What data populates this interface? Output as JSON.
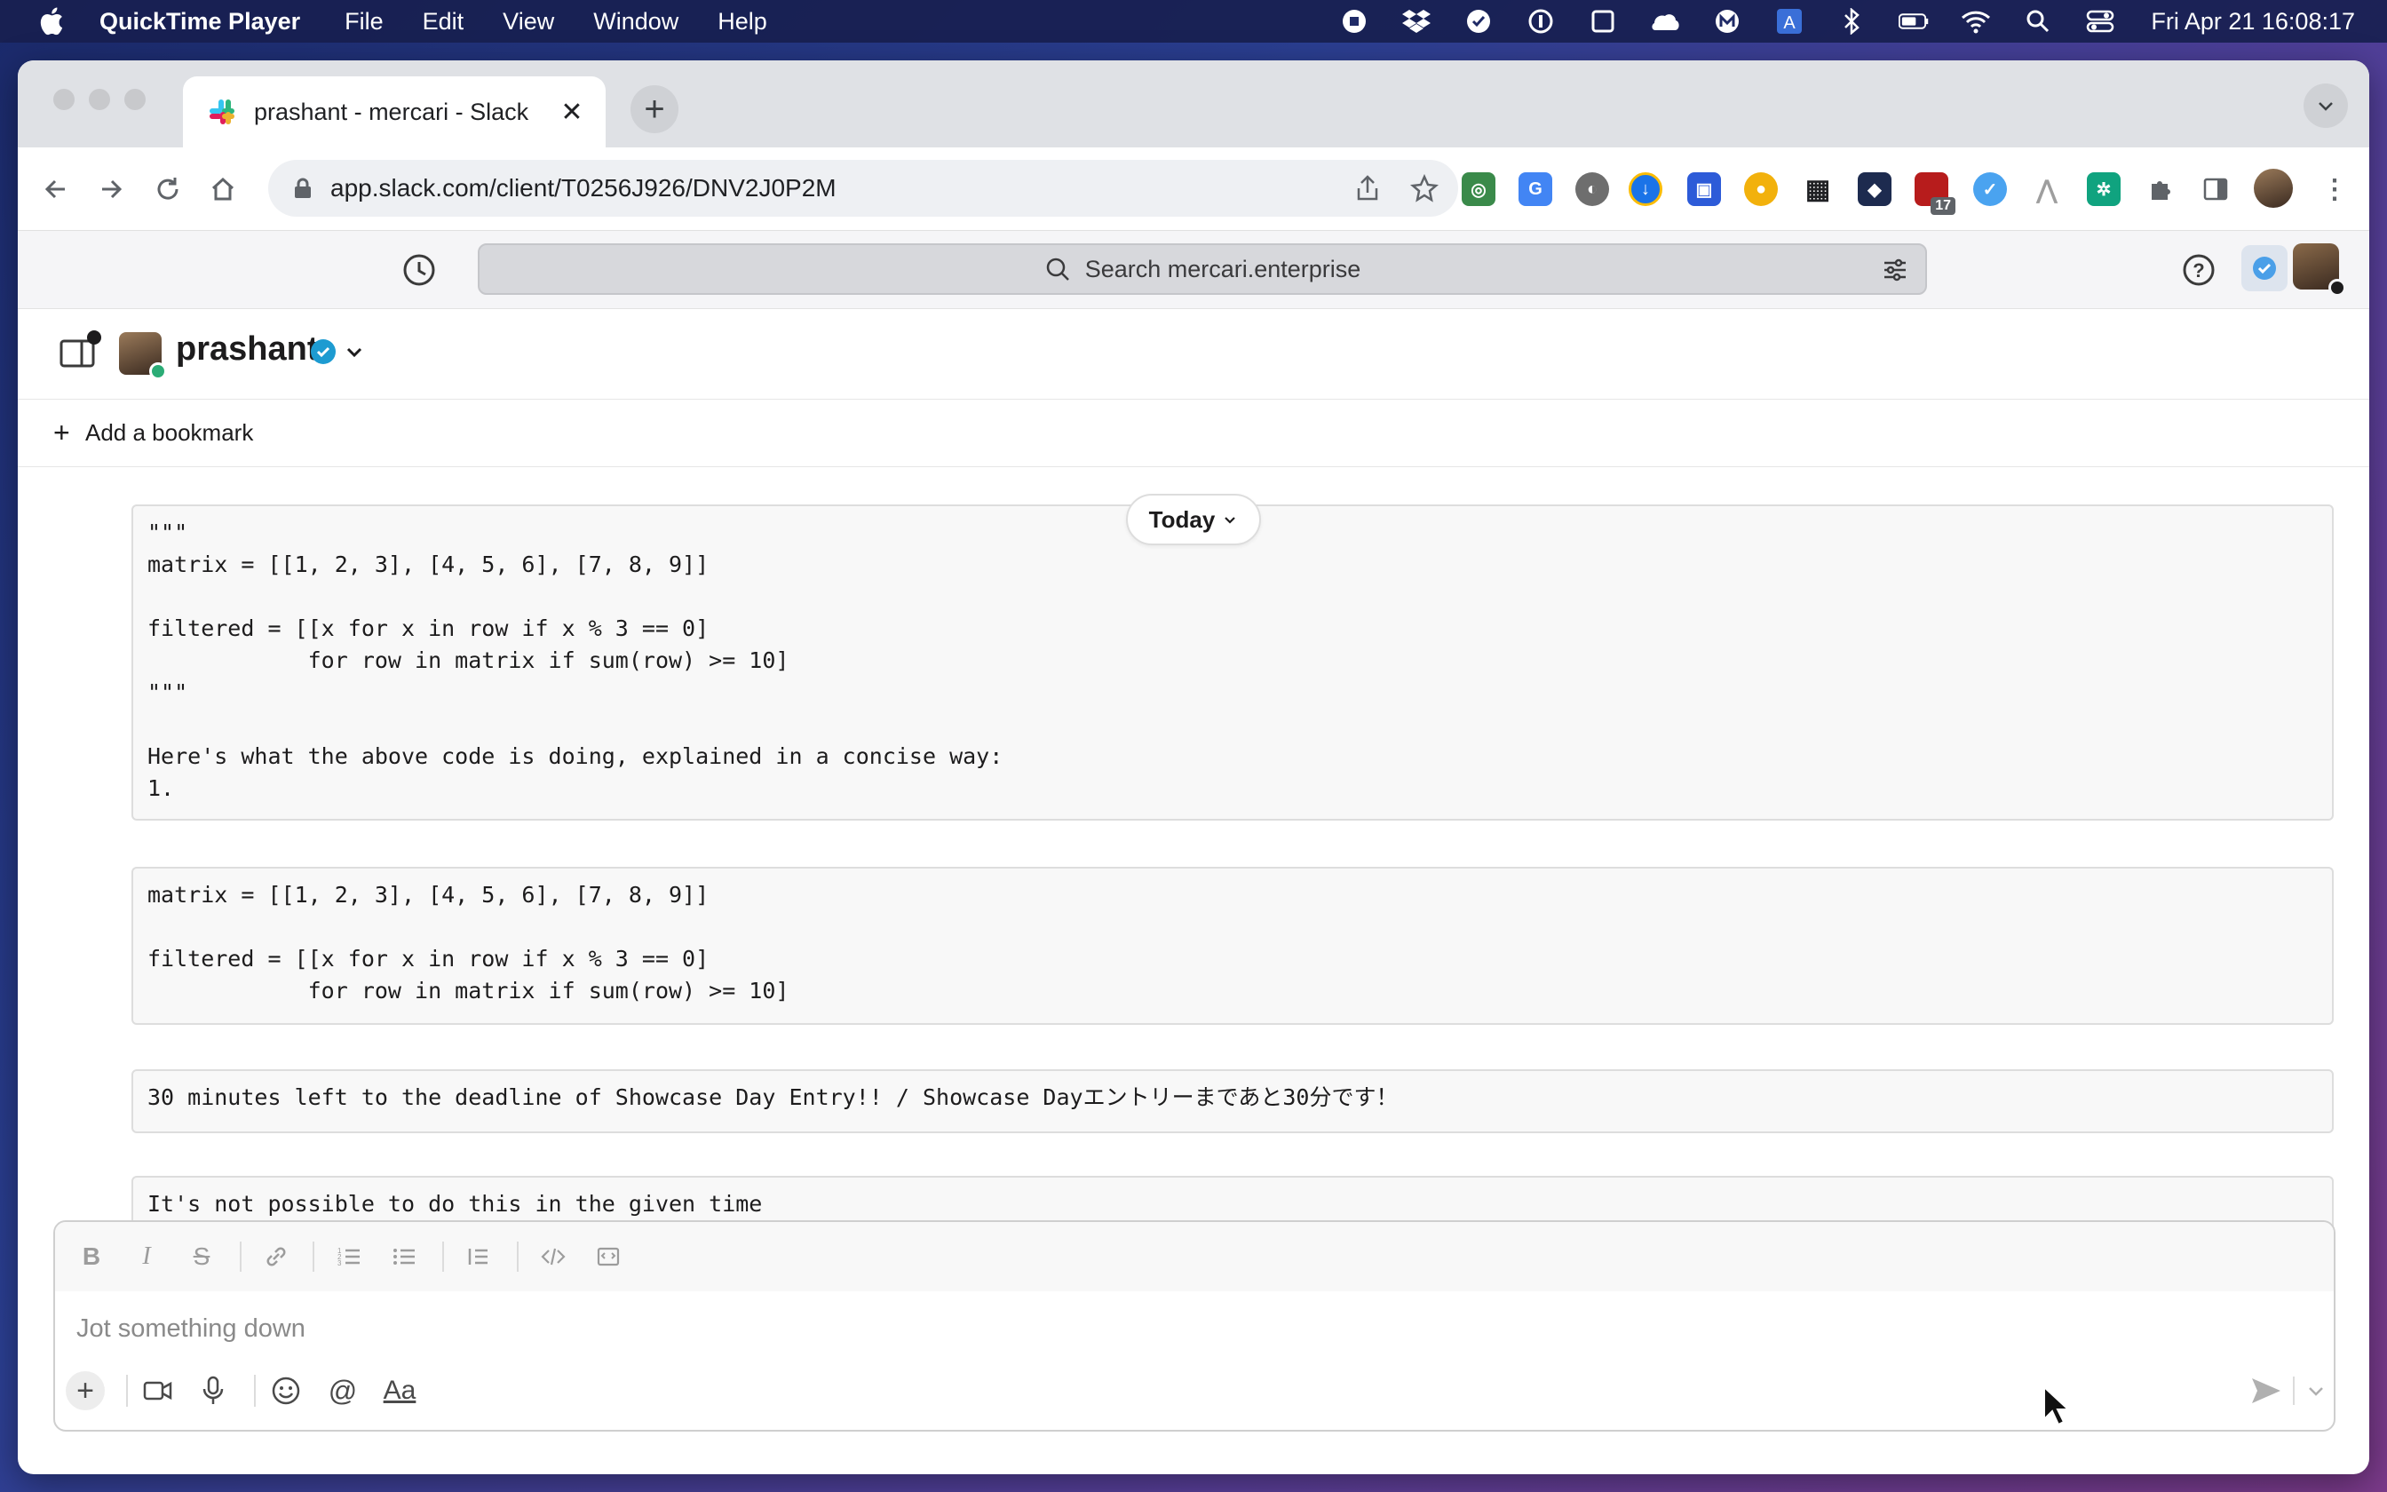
{
  "menubar": {
    "app_name": "QuickTime Player",
    "menus": [
      "File",
      "Edit",
      "View",
      "Window",
      "Help"
    ],
    "clock": "Fri Apr 21  16:08:17"
  },
  "browser": {
    "tab_title": "prashant - mercari - Slack",
    "url": "app.slack.com/client/T0256J926/DNV2J0P2M",
    "extension_badge": "17"
  },
  "slack": {
    "search_placeholder": "Search mercari.enterprise",
    "channel_name": "prashant",
    "add_bookmark": "Add a bookmark",
    "today_label": "Today"
  },
  "messages": [
    {
      "text": "\"\"\"\nmatrix = [[1, 2, 3], [4, 5, 6], [7, 8, 9]]\n\nfiltered = [[x for x in row if x % 3 == 0]\n            for row in matrix if sum(row) >= 10]\n\"\"\"\n\nHere's what the above code is doing, explained in a concise way:\n1."
    },
    {
      "text": "matrix = [[1, 2, 3], [4, 5, 6], [7, 8, 9]]\n\nfiltered = [[x for x in row if x % 3 == 0]\n            for row in matrix if sum(row) >= 10]"
    },
    {
      "text": "30 minutes left to the deadline of Showcase Day Entry!! / Showcase Dayエントリーまであと30分です！"
    },
    {
      "text": "It's not possible to do this in the given time"
    }
  ],
  "composer": {
    "placeholder": "Jot something down",
    "format_label": "Aa"
  },
  "colors": {
    "slack_green": "#2bac76",
    "verified_blue": "#1d9bd1"
  }
}
